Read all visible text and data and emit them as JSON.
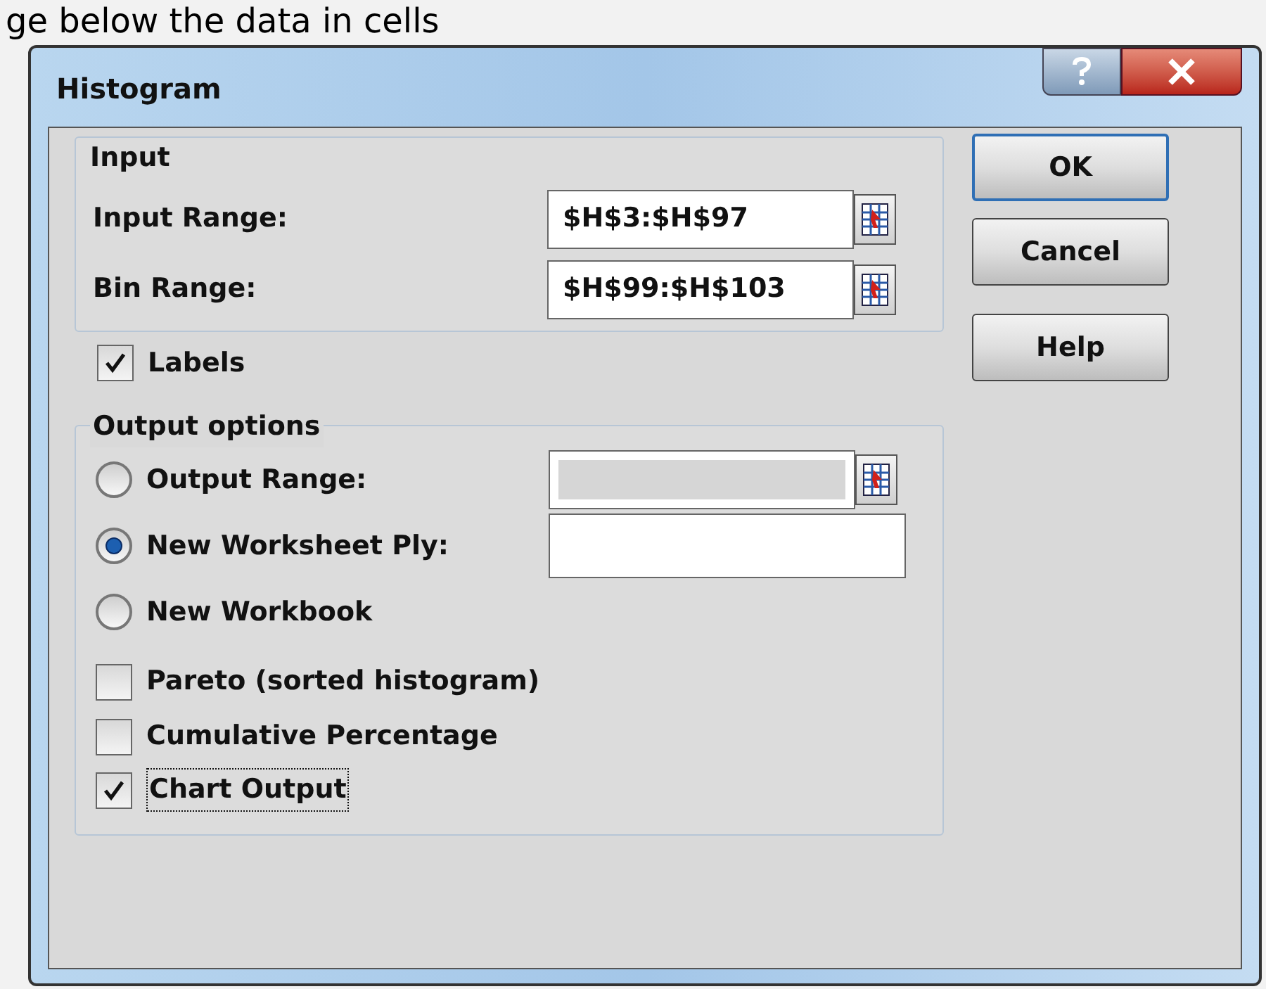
{
  "background_text": "ge below the data in cells",
  "window": {
    "title": "Histogram"
  },
  "input_group": {
    "title": "Input",
    "fields": [
      {
        "label": "Input Range:",
        "value": "$H$3:$H$97"
      },
      {
        "label": "Bin Range:",
        "value": "$H$99:$H$103"
      }
    ],
    "labels_checkbox": {
      "label": "Labels",
      "checked": true
    }
  },
  "output_group": {
    "title": "Output options",
    "options": [
      {
        "kind": "radio",
        "label": "Output Range:",
        "selected": false,
        "field": {
          "kind": "range",
          "disabled": true
        }
      },
      {
        "kind": "radio",
        "label": "New Worksheet Ply:",
        "selected": true,
        "field": {
          "kind": "text"
        }
      },
      {
        "kind": "radio",
        "label": "New Workbook",
        "selected": false
      },
      {
        "kind": "checkbox",
        "label": "Pareto (sorted histogram)",
        "checked": false,
        "focused": false
      },
      {
        "kind": "checkbox",
        "label": "Cumulative Percentage",
        "checked": false,
        "focused": false
      },
      {
        "kind": "checkbox",
        "label": "Chart Output",
        "checked": true,
        "focused": true
      }
    ]
  },
  "buttons": [
    {
      "label": "OK",
      "default": true
    },
    {
      "label": "Cancel",
      "default": false
    },
    {
      "label": "Help",
      "default": false
    }
  ]
}
